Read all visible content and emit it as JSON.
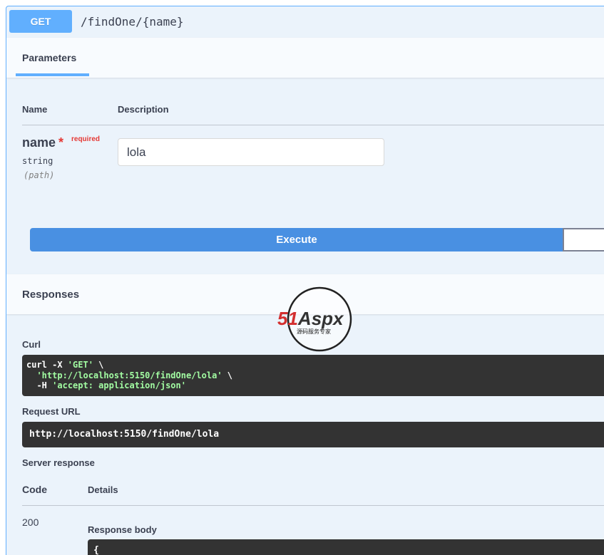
{
  "operation": {
    "method": "GET",
    "path": "/findOne/{name}"
  },
  "parameters_tab": {
    "label": "Parameters"
  },
  "param_table": {
    "col_name": "Name",
    "col_description": "Description"
  },
  "param": {
    "name": "name",
    "star": "*",
    "required_label": "required",
    "type": "string",
    "in": "(path)",
    "value": "lola"
  },
  "execute_label": "Execute",
  "responses": {
    "title": "Responses",
    "curl_label": "Curl",
    "curl": {
      "line1_prefix": "curl -X ",
      "line1_str": "'GET'",
      "line1_suffix": " \\",
      "line2_str": "'http://localhost:5150/findOne/lola'",
      "line2_suffix": " \\",
      "line3_prefix": "-H ",
      "line3_str": "'accept: application/json'"
    },
    "request_url_label": "Request URL",
    "request_url": "http://localhost:5150/findOne/lola",
    "server_response_label": "Server response",
    "col_code": "Code",
    "col_details": "Details",
    "status_code": "200",
    "response_body_label": "Response body",
    "response_body_start": "{"
  },
  "watermark": {
    "brand": "51Aspx",
    "tagline": "源码服务专家"
  },
  "colors": {
    "get_accent": "#61affe",
    "execute": "#4990e2",
    "code_bg": "#333333",
    "required": "#e53935"
  }
}
